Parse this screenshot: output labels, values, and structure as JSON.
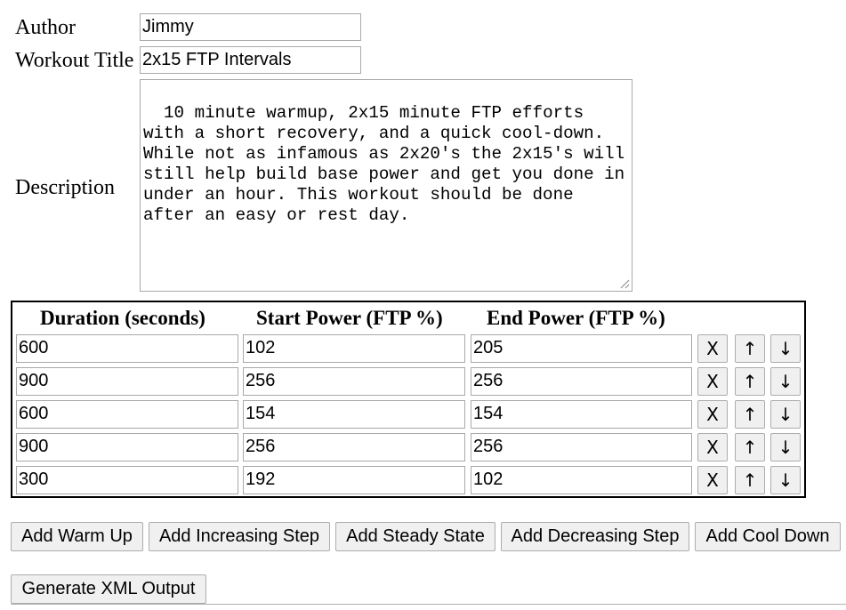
{
  "form": {
    "author_label": "Author",
    "author_value": "Jimmy",
    "title_label": "Workout Title",
    "title_value": "2x15 FTP Intervals",
    "description_label": "Description",
    "description_value": "10 minute warmup, 2x15 minute FTP efforts with a short recovery, and a quick cool-down. While not as infamous as 2x20's the 2x15's will still help build base power and get you done in under an hour. This workout should be done after an easy or rest day."
  },
  "steps": {
    "headers": [
      "Duration (seconds)",
      "Start Power (FTP %)",
      "End Power (FTP %)"
    ],
    "rows": [
      {
        "duration": "600",
        "start": "102",
        "end": "205"
      },
      {
        "duration": "900",
        "start": "256",
        "end": "256"
      },
      {
        "duration": "600",
        "start": "154",
        "end": "154"
      },
      {
        "duration": "900",
        "start": "256",
        "end": "256"
      },
      {
        "duration": "300",
        "start": "192",
        "end": "102"
      }
    ],
    "delete_label": "X",
    "up_label": "↑",
    "down_label": "↓"
  },
  "actions": {
    "add_warm_up": "Add Warm Up",
    "add_increasing": "Add Increasing Step",
    "add_steady": "Add Steady State",
    "add_decreasing": "Add Decreasing Step",
    "add_cool_down": "Add Cool Down",
    "generate_xml": "Generate XML Output"
  }
}
